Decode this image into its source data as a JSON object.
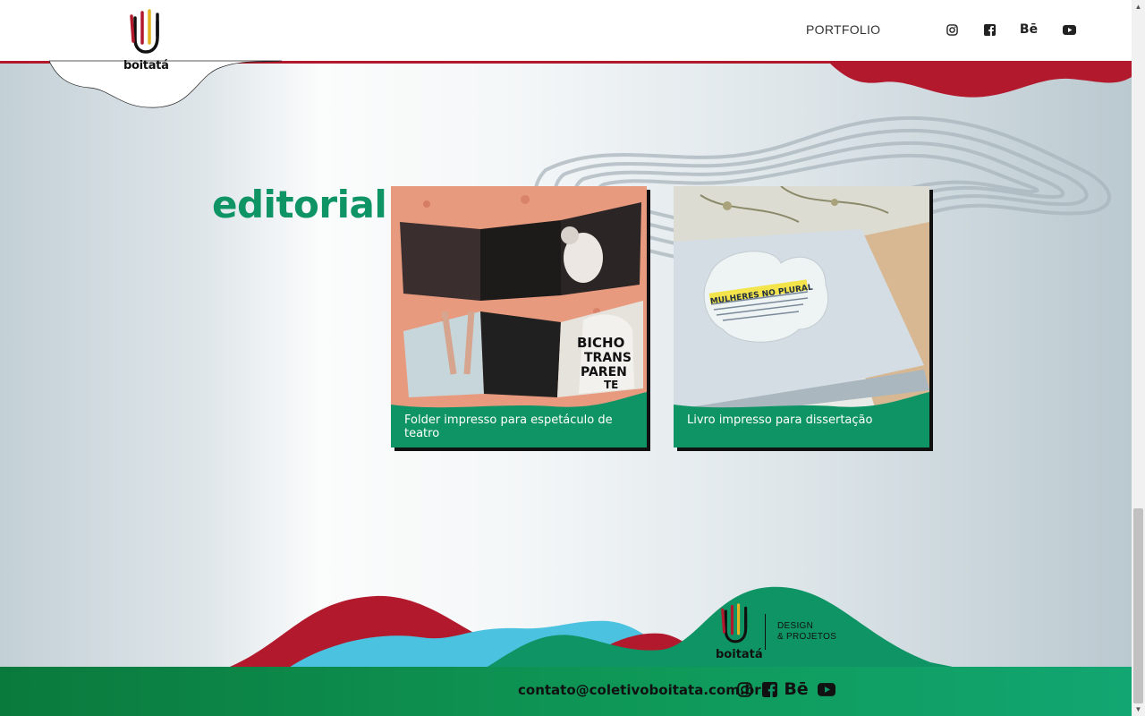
{
  "header": {
    "logo_text": "boitatá",
    "nav_portfolio": "PORTFOLIO",
    "social": [
      {
        "name": "instagram-icon"
      },
      {
        "name": "facebook-icon"
      },
      {
        "name": "behance-icon",
        "label": "Bē"
      },
      {
        "name": "youtube-icon"
      }
    ]
  },
  "section": {
    "title": "editorial",
    "cards": [
      {
        "caption": "Folder impresso para espetáculo de teatro",
        "image_words": [
          "BICHO",
          "TRANS",
          "PAREN",
          "TE"
        ]
      },
      {
        "caption": "Livro impresso para dissertação",
        "image_words": [
          "MULHERES NO PLURAL"
        ]
      }
    ]
  },
  "footer": {
    "logo_text": "boitatá",
    "tagline_1": "DESIGN",
    "tagline_2": "& PROJETOS",
    "email": "contato@coletivoboitata.com.br",
    "behance_label": "Bē"
  },
  "colors": {
    "brand_green": "#0f9466",
    "brand_red": "#b2192d",
    "brand_cyan": "#4bc3e0",
    "text_dark": "#111111"
  }
}
